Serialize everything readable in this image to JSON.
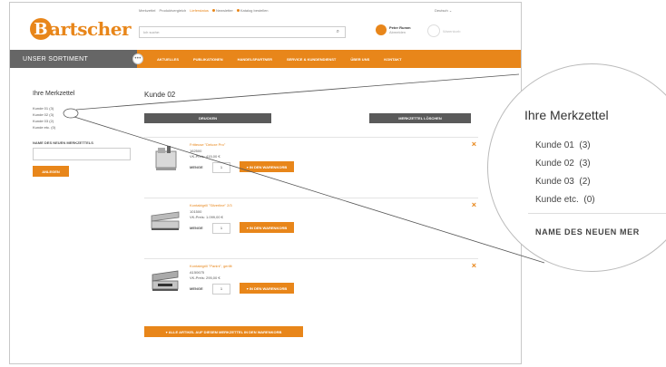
{
  "topbar": {
    "links": [
      "Merkzettel",
      "Produktvergleich",
      "Lieferstatus",
      "Newsletter",
      "Katalog bestellen"
    ],
    "language": "Deutsch"
  },
  "brand": {
    "logo_letter": "B",
    "logo_text": "artscher"
  },
  "search": {
    "placeholder": "Ich suche:"
  },
  "account": {
    "name": "Peter Rumm",
    "sub": "Abmelden"
  },
  "cart": {
    "label": "Warenkorb"
  },
  "nav": {
    "sortiment": "UNSER SORTIMENT",
    "items": [
      "AKTUELLES",
      "PUBLIKATIONEN",
      "HANDELSPARTNER",
      "SERVICE & KUNDENDIENST",
      "ÜBER UNS",
      "KONTAKT"
    ]
  },
  "sidebar": {
    "title": "Ihre Merkzettel",
    "lists": [
      {
        "name": "Kunde 01",
        "count": "(3)"
      },
      {
        "name": "Kunde 02",
        "count": "(3)"
      },
      {
        "name": "Kunde 03",
        "count": "(2)"
      },
      {
        "name": "Kunde etc.",
        "count": "(0)"
      }
    ],
    "new_label": "NAME DES NEUEN MERKZETTELS",
    "create_button": "ANLEGEN"
  },
  "main": {
    "title": "Kunde 02",
    "print_button": "DRUCKEN",
    "delete_button": "MERKZETTEL LÖSCHEN",
    "qty_label": "MENGE",
    "add_button": "IN DEN WARENKORB",
    "products": [
      {
        "name": "Fritteuse \"Deluxe Pro\"",
        "number": "162500",
        "price": "VK-Preis: 415,00 €",
        "qty": "1"
      },
      {
        "name": "Kontaktgrill \"Silverline\" 2/3",
        "number": "101500",
        "price": "VK-Preis: 1.099,00 €",
        "qty": "1"
      },
      {
        "name": "Kontaktgrill \"Panini\", gerillt",
        "number": "A150675",
        "price": "VK-Preis: 295,00 €",
        "qty": "1"
      }
    ],
    "add_all_button": "ALLE ARTIKEL AUF DIESEM MERKZETTEL IN DEN WARENKORB"
  },
  "zoom": {
    "title": "Ihre Merkzettel",
    "lists": [
      {
        "name": "Kunde 01",
        "count": "(3)"
      },
      {
        "name": "Kunde 02",
        "count": "(3)"
      },
      {
        "name": "Kunde 03",
        "count": "(2)"
      },
      {
        "name": "Kunde etc.",
        "count": "(0)"
      }
    ],
    "new_label": "NAME DES NEUEN MER"
  },
  "colors": {
    "accent": "#e8861a",
    "dark": "#5a5a5a"
  }
}
